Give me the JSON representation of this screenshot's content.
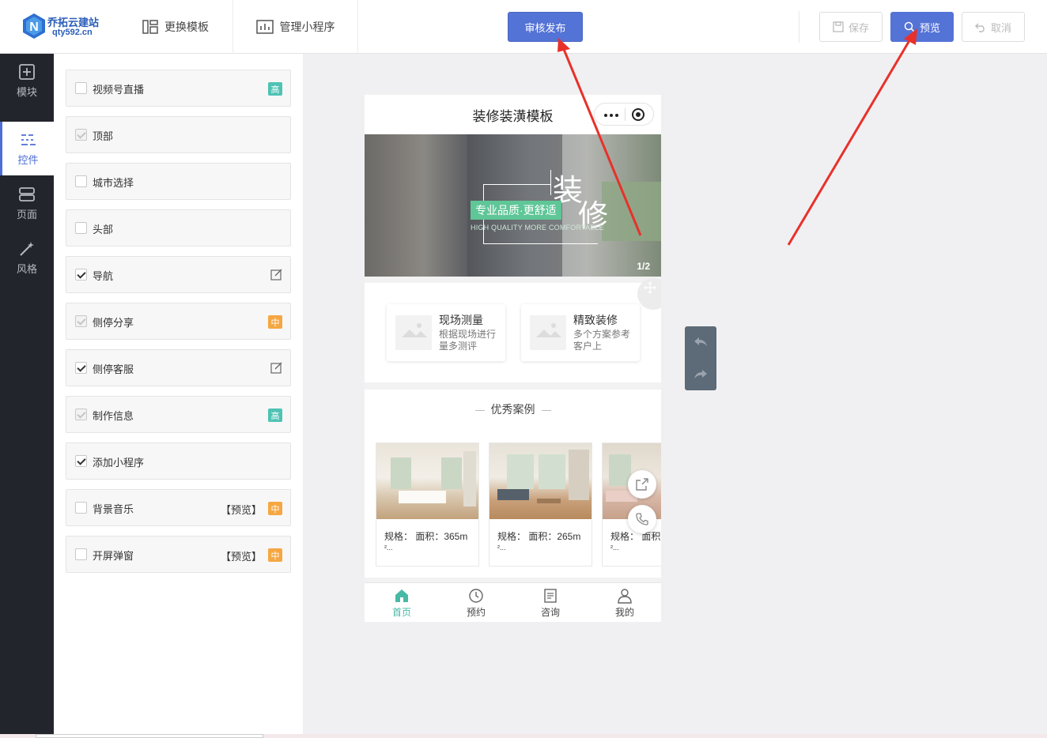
{
  "logo": {
    "name": "乔拓云建站",
    "domain": "qty592.cn"
  },
  "toolbar": {
    "change_template": "更换模板",
    "manage_miniprogram": "管理小程序",
    "publish": "审核发布",
    "save": "保存",
    "preview": "预览",
    "cancel": "取消"
  },
  "rail": [
    {
      "label": "模块",
      "icon": "plus-square-icon"
    },
    {
      "label": "控件",
      "icon": "sliders-icon",
      "active": true
    },
    {
      "label": "页面",
      "icon": "page-layers-icon"
    },
    {
      "label": "风格",
      "icon": "magic-wand-icon"
    }
  ],
  "controls": [
    {
      "label": "视频号直播",
      "state": "unchecked",
      "badge": "高"
    },
    {
      "label": "顶部",
      "state": "disabled-checked"
    },
    {
      "label": "城市选择",
      "state": "unchecked"
    },
    {
      "label": "头部",
      "state": "unchecked"
    },
    {
      "label": "导航",
      "state": "checked",
      "edit": true
    },
    {
      "label": "侧停分享",
      "state": "disabled-checked",
      "badge": "中"
    },
    {
      "label": "侧停客服",
      "state": "checked",
      "edit": true
    },
    {
      "label": "制作信息",
      "state": "disabled-checked",
      "badge": "高"
    },
    {
      "label": "添加小程序",
      "state": "checked"
    },
    {
      "label": "背景音乐",
      "state": "unchecked",
      "preview": "【预览】",
      "badge": "中"
    },
    {
      "label": "开屏弹窗",
      "state": "unchecked",
      "preview": "【预览】",
      "badge": "中"
    }
  ],
  "phone": {
    "title": "装修装潢模板",
    "banner": {
      "big1": "装",
      "big2": "修",
      "slogan": "专业品质·更舒适",
      "sub": "HIGH QUALITY MORE COMFORTABLE",
      "page": "1/2"
    },
    "services": [
      {
        "title": "现场测量",
        "desc": "根据现场进行量多测评"
      },
      {
        "title": "精致装修",
        "desc": "多个方案参考客户上"
      }
    ],
    "cases_title": "优秀案例",
    "cases": [
      {
        "line1": "规格： 面积：365m",
        "line2": "²..."
      },
      {
        "line1": "规格： 面积：265m",
        "line2": "²..."
      },
      {
        "line1": "规格： 面积",
        "line2": "²..."
      }
    ],
    "tabs": [
      {
        "label": "首页",
        "icon": "home-icon",
        "active": true
      },
      {
        "label": "预约",
        "icon": "clock-icon"
      },
      {
        "label": "咨询",
        "icon": "document-icon"
      },
      {
        "label": "我的",
        "icon": "user-icon"
      }
    ]
  },
  "colors": {
    "accent": "#5473d6",
    "rail": "#22252c",
    "tab_active": "#47b9a6",
    "badge_high": "#4fc3b4",
    "badge_mid": "#f5a742",
    "arrow": "#e8312a"
  }
}
